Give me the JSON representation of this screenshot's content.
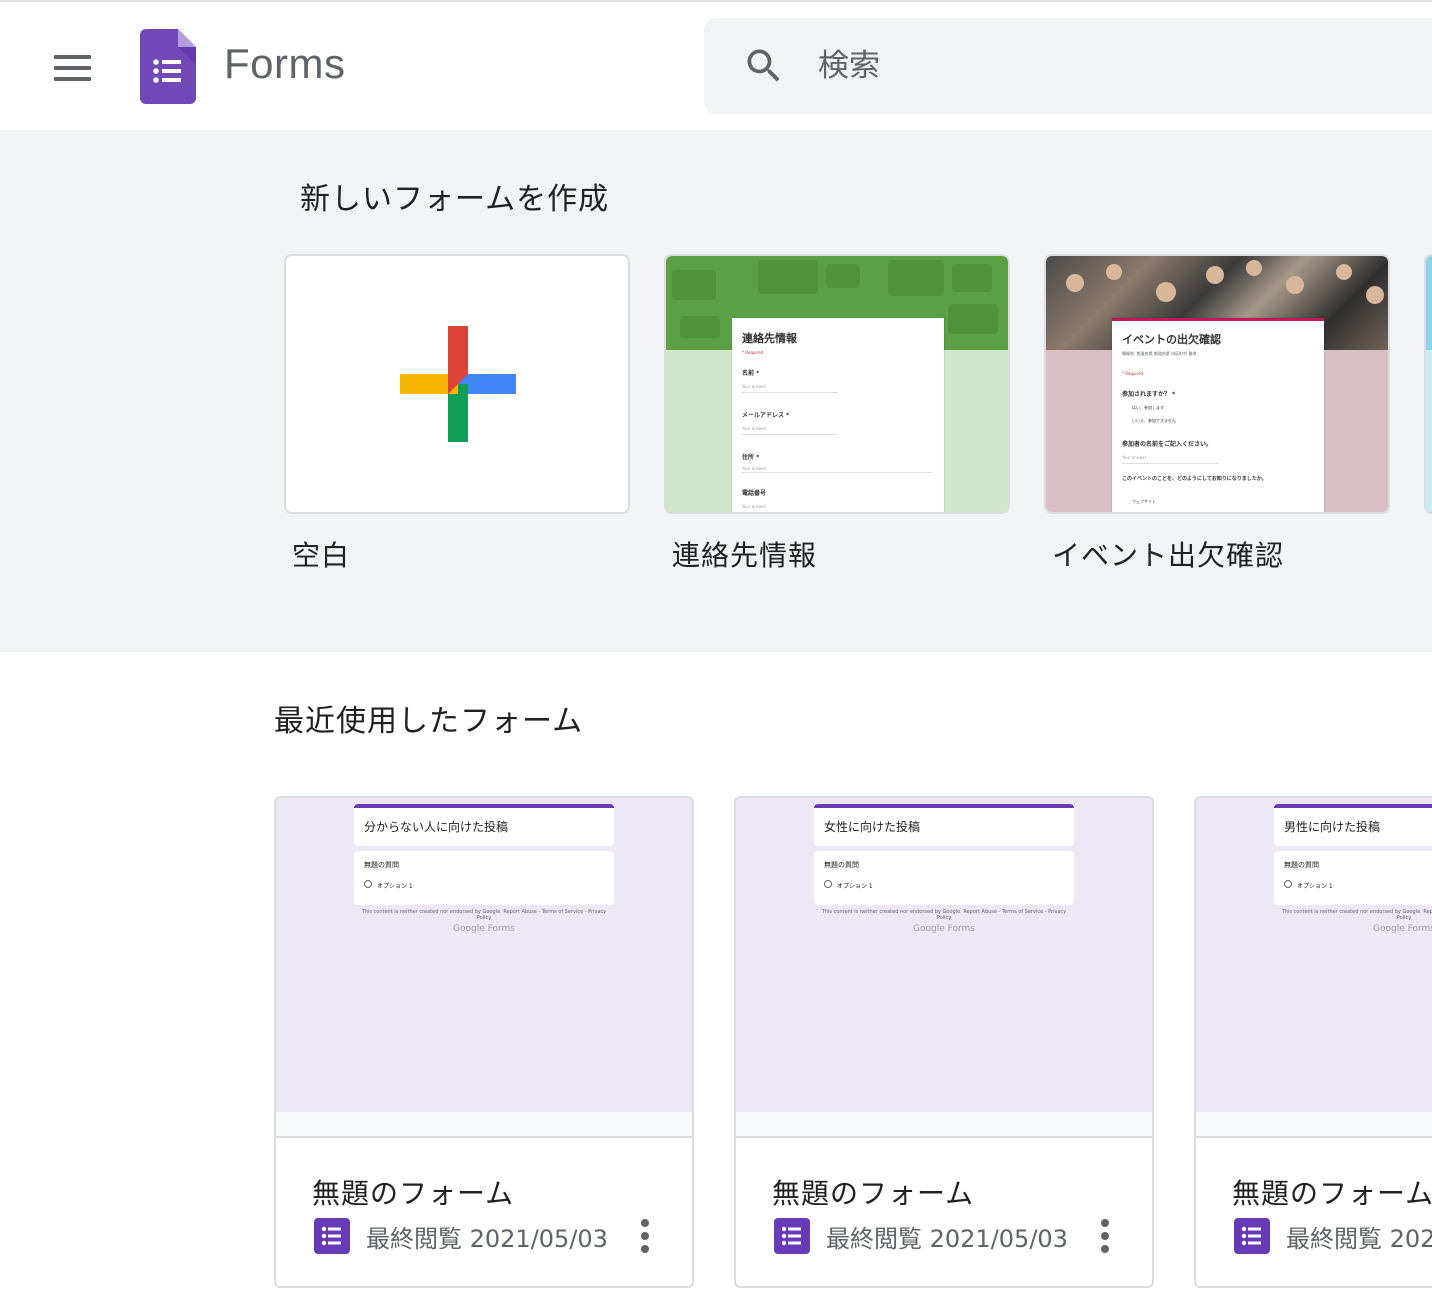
{
  "header": {
    "app_title": "Forms",
    "search_placeholder": "検索"
  },
  "templates": {
    "heading": "新しいフォームを作成",
    "items": [
      {
        "label": "空白"
      },
      {
        "label": "連絡先情報",
        "preview": {
          "title": "連絡先情報",
          "required": "* Required",
          "fields": [
            "名前 *",
            "メールアドレス *",
            "住所 *",
            "電話番号"
          ],
          "answer": "Your answer"
        }
      },
      {
        "label": "イベント出欠確認",
        "preview": {
          "title": "イベントの出欠確認",
          "details": "開催地: 都道府県 都道府県 市区町村 番地",
          "required": "* Required",
          "q1": "参加されますか？ *",
          "q1_opt1": "はい、参加します",
          "q1_opt2": "いいえ、参加できません",
          "q2": "参加者の名前をご記入ください。",
          "answer": "Your answer",
          "q3": "このイベントのことを、どのようにしてお知りになりましたか。",
          "q3_opt1": "ウェブサイト"
        }
      }
    ]
  },
  "recent": {
    "heading": "最近使用したフォーム",
    "forms": [
      {
        "thumb_title": "分からない人に向けた投稿",
        "thumb_question": "無題の質問",
        "thumb_option": "オプション 1",
        "thumb_footer": "This content is neither created nor endorsed by Google. Report Abuse - Terms of Service - Privacy Policy",
        "thumb_brand": "Google Forms",
        "name": "無題のフォーム",
        "opened": "最終閲覧 2021/05/03"
      },
      {
        "thumb_title": "女性に向けた投稿",
        "thumb_question": "無題の質問",
        "thumb_option": "オプション 1",
        "thumb_footer": "This content is neither created nor endorsed by Google. Report Abuse - Terms of Service - Privacy Policy",
        "thumb_brand": "Google Forms",
        "name": "無題のフォーム",
        "opened": "最終閲覧 2021/05/03"
      },
      {
        "thumb_title": "男性に向けた投稿",
        "thumb_question": "無題の質問",
        "thumb_option": "オプション 1",
        "thumb_footer": "This content is neither created nor endorsed by Google. Report Abuse - Terms of Service - Privacy Policy",
        "thumb_brand": "Google Forms",
        "name": "無題のフォーム",
        "opened": "最終閲覧 202"
      }
    ]
  },
  "icons": {
    "menu": "menu-icon",
    "logo": "google-forms-logo",
    "search": "search-icon",
    "plus": "google-plus-icon",
    "file": "forms-file-icon",
    "more": "more-vertical-icon"
  },
  "colors": {
    "forms_purple": "#673ab7",
    "logo_purple": "#7248b9",
    "contact_green": "#5aa145",
    "contact_light": "#d1e7cc",
    "event_pink": "#d9bfc3",
    "thumb_lavender": "#ede7f6",
    "plus_red": "#db4437",
    "plus_blue": "#4285f4",
    "plus_green": "#0f9d58",
    "plus_yellow": "#f4b400"
  }
}
